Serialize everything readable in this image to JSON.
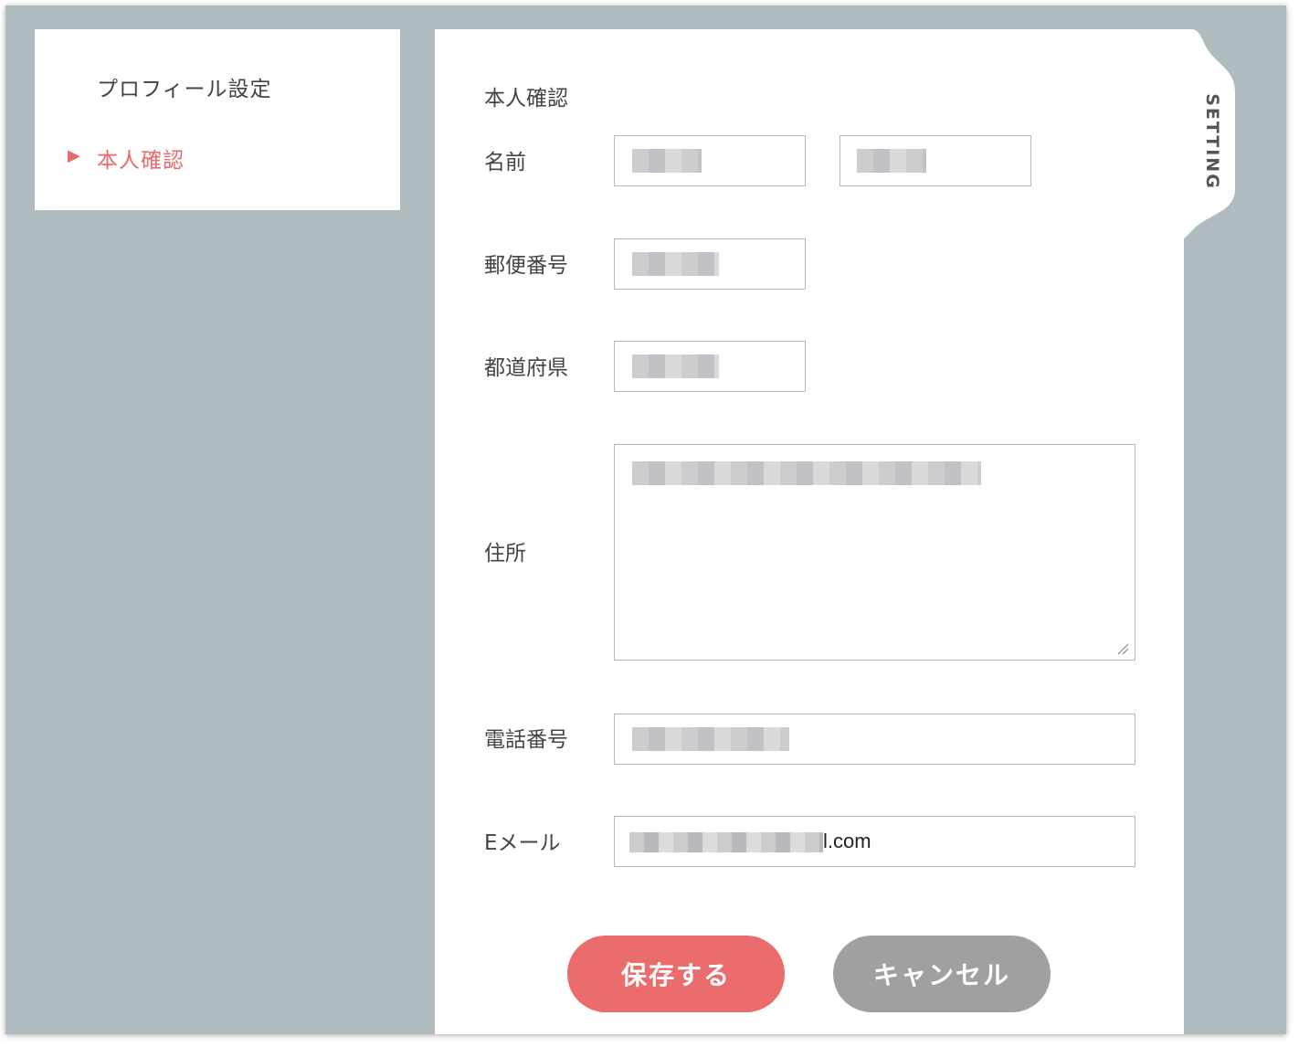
{
  "sidebar": {
    "items": [
      {
        "label": "プロフィール設定"
      },
      {
        "label": "本人確認"
      }
    ],
    "active_marker": "▶"
  },
  "tab": {
    "label": "SETTING"
  },
  "form": {
    "title": "本人確認",
    "name_label": "名前",
    "postal_label": "郵便番号",
    "prefecture_label": "都道府県",
    "address_label": "住所",
    "phone_label": "電話番号",
    "email_label": "Eメール",
    "email_value": "l.com"
  },
  "buttons": {
    "save_label": "保存する",
    "cancel_label": "キャンセル"
  },
  "colors": {
    "accent": "#ea6c6c",
    "cancel": "#a0a0a0",
    "background": "#b0bbbf"
  }
}
